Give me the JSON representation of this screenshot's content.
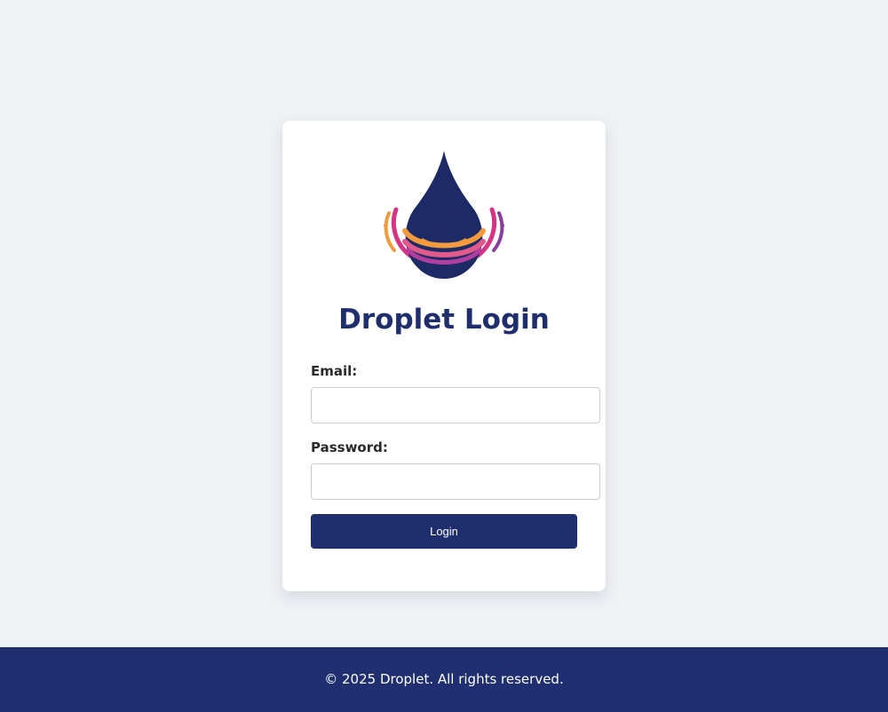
{
  "login": {
    "title": "Droplet Login",
    "email_label": "Email:",
    "email_value": "",
    "password_label": "Password:",
    "password_value": "",
    "submit_label": "Login"
  },
  "footer": {
    "text": "© 2025 Droplet. All rights reserved."
  },
  "colors": {
    "brand_navy": "#1f2f6e",
    "background": "#eff1f5",
    "logo_orange": "#f29a3c",
    "logo_magenta": "#d63384",
    "logo_purple": "#8a3fa0"
  },
  "icons": {
    "logo": "droplet-logo-icon"
  }
}
